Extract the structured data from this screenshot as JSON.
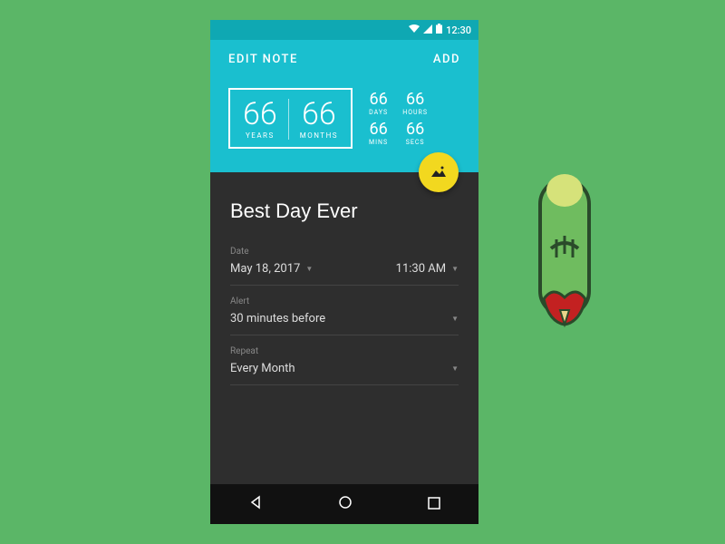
{
  "statusbar": {
    "time": "12:30"
  },
  "header": {
    "edit_note": "EDIT NOTE",
    "add": "ADD"
  },
  "countdown": {
    "years": {
      "value": "66",
      "label": "YEARS"
    },
    "months": {
      "value": "66",
      "label": "MONTHS"
    },
    "days": {
      "value": "66",
      "label": "DAYS"
    },
    "hours": {
      "value": "66",
      "label": "HOURS"
    },
    "mins": {
      "value": "66",
      "label": "MINS"
    },
    "secs": {
      "value": "66",
      "label": "SECS"
    }
  },
  "note": {
    "title": "Best Day Ever",
    "date_label": "Date",
    "date_value": "May 18, 2017",
    "time_value": "11:30 AM",
    "alert_label": "Alert",
    "alert_value": "30 minutes before",
    "repeat_label": "Repeat",
    "repeat_value": "Every Month"
  },
  "colors": {
    "background": "#5bb667",
    "header": "#1abfcf",
    "statusbar": "#0fa8b3",
    "fab": "#f2d81f",
    "form_bg": "#2e2e2e"
  }
}
